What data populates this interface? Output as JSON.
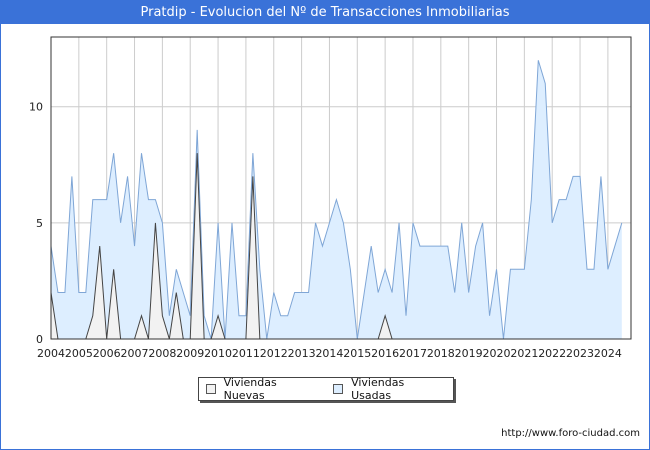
{
  "title": "Pratdip - Evolucion del Nº de Transacciones Inmobiliarias",
  "footer_url": "http://www.foro-ciudad.com",
  "colors": {
    "title_bg": "#3a72d8",
    "nuevas_fill": "#f2f2f2",
    "nuevas_line": "#444444",
    "usadas_fill": "#ddeeff",
    "usadas_line": "#7fa6d6"
  },
  "legend": {
    "nuevas": "Viviendas Nuevas",
    "usadas": "Viviendas Usadas"
  },
  "chart_data": {
    "type": "area",
    "xlim": [
      2004,
      2024.83
    ],
    "ylim": [
      0,
      13
    ],
    "x_ticks": [
      "2004",
      "2005",
      "2006",
      "2007",
      "2008",
      "2009",
      "2010",
      "2011",
      "2012",
      "2013",
      "2014",
      "2015",
      "2016",
      "2017",
      "2018",
      "2019",
      "2020",
      "2021",
      "2022",
      "2023",
      "2024"
    ],
    "y_ticks": [
      0,
      5,
      10
    ],
    "grid": true,
    "legend_position": "bottom-center",
    "start": 2004,
    "step": 0.25,
    "series": [
      {
        "name": "Viviendas Usadas",
        "values": [
          4,
          2,
          2,
          7,
          2,
          2,
          6,
          6,
          6,
          8,
          5,
          7,
          4,
          8,
          6,
          6,
          5,
          1,
          3,
          2,
          1,
          9,
          1,
          0,
          5,
          0,
          5,
          1,
          1,
          8,
          3,
          0,
          2,
          1,
          1,
          2,
          2,
          2,
          5,
          4,
          5,
          6,
          5,
          3,
          0,
          2,
          4,
          2,
          3,
          2,
          5,
          1,
          5,
          4,
          4,
          4,
          4,
          4,
          2,
          5,
          2,
          4,
          5,
          1,
          3,
          0,
          3,
          3,
          3,
          6,
          12,
          11,
          5,
          6,
          6,
          7,
          7,
          3,
          3,
          7,
          3,
          4,
          5
        ]
      },
      {
        "name": "Viviendas Nuevas",
        "values": [
          2,
          0,
          0,
          0,
          0,
          0,
          1,
          4,
          0,
          3,
          0,
          0,
          0,
          1,
          0,
          5,
          1,
          0,
          2,
          0,
          0,
          8,
          0,
          0,
          1,
          0,
          0,
          0,
          0,
          7,
          0,
          0,
          0,
          0,
          0,
          0,
          0,
          0,
          0,
          0,
          0,
          0,
          0,
          0,
          0,
          0,
          0,
          0,
          1,
          0,
          0,
          0,
          0,
          0,
          0,
          0,
          0,
          0,
          0,
          0,
          0,
          0,
          0,
          0,
          0,
          0,
          0,
          0,
          0,
          0,
          0,
          0,
          0,
          0,
          0,
          0,
          0,
          0,
          0,
          0,
          0,
          0,
          0
        ]
      }
    ]
  }
}
